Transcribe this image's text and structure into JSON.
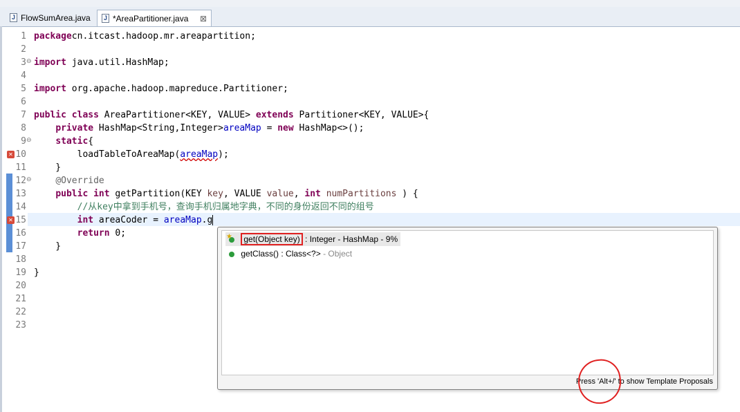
{
  "tabs": [
    {
      "label": "FlowSumArea.java",
      "active": false
    },
    {
      "label": "*AreaPartitioner.java",
      "active": true,
      "close": "⊠"
    }
  ],
  "lines": [
    {
      "n": "1",
      "segs": [
        [
          "kw",
          "package"
        ],
        [
          "",
          "cn.itcast.hadoop.mr.areapartition;"
        ]
      ]
    },
    {
      "n": "2",
      "segs": []
    },
    {
      "n": "3",
      "fold": "⊖",
      "segs": [
        [
          "kw",
          "import"
        ],
        [
          "",
          " java.util.HashMap;"
        ]
      ]
    },
    {
      "n": "4",
      "segs": []
    },
    {
      "n": "5",
      "segs": [
        [
          "kw",
          "import"
        ],
        [
          "",
          " org.apache.hadoop.mapreduce.Partitioner;"
        ]
      ]
    },
    {
      "n": "6",
      "segs": []
    },
    {
      "n": "7",
      "segs": [
        [
          "kw",
          "public class"
        ],
        [
          "",
          " AreaPartitioner<KEY, VALUE> "
        ],
        [
          "kw",
          "extends"
        ],
        [
          "",
          " Partitioner<KEY, VALUE>{"
        ]
      ]
    },
    {
      "n": "8",
      "segs": [
        [
          "",
          "    "
        ],
        [
          "kw",
          "private"
        ],
        [
          "",
          " HashMap<String,Integer>"
        ],
        [
          "field",
          "areaMap"
        ],
        [
          "",
          " = "
        ],
        [
          "kw",
          "new"
        ],
        [
          "",
          " HashMap<>();"
        ]
      ]
    },
    {
      "n": "9",
      "fold": "⊖",
      "segs": [
        [
          "",
          "    "
        ],
        [
          "kw",
          "static"
        ],
        [
          "",
          "{"
        ]
      ]
    },
    {
      "n": "10",
      "err": true,
      "segs": [
        [
          "",
          "        loadTableToAreaMap("
        ],
        [
          "field squig",
          "areaMap"
        ],
        [
          "",
          ");"
        ]
      ]
    },
    {
      "n": "11",
      "segs": [
        [
          "",
          "    }"
        ]
      ]
    },
    {
      "n": "12",
      "fold": "⊖",
      "segs": [
        [
          "",
          "    "
        ],
        [
          "ann",
          "@Override"
        ]
      ]
    },
    {
      "n": "13",
      "segs": [
        [
          "",
          "    "
        ],
        [
          "kw",
          "public int"
        ],
        [
          "",
          " getPartition(KEY "
        ],
        [
          "param",
          "key"
        ],
        [
          "",
          ", VALUE "
        ],
        [
          "param",
          "value"
        ],
        [
          "",
          ", "
        ],
        [
          "kw",
          "int"
        ],
        [
          "",
          " "
        ],
        [
          "param",
          "numPartitions"
        ],
        [
          "",
          " ) {"
        ]
      ]
    },
    {
      "n": "14",
      "segs": [
        [
          "",
          "        "
        ],
        [
          "cmt",
          "//从key中拿到手机号，查询手机归属地字典，不同的身份返回不同的组号"
        ]
      ]
    },
    {
      "n": "15",
      "err": true,
      "caret": true,
      "segs": [
        [
          "",
          "        "
        ],
        [
          "kw",
          "int"
        ],
        [
          "",
          " areaCoder = "
        ],
        [
          "field",
          "areaMap"
        ],
        [
          "",
          ".g"
        ]
      ]
    },
    {
      "n": "16",
      "segs": [
        [
          "",
          "        "
        ],
        [
          "kw",
          "return"
        ],
        [
          "",
          " 0;"
        ]
      ]
    },
    {
      "n": "17",
      "segs": [
        [
          "",
          "    }"
        ]
      ]
    },
    {
      "n": "18",
      "segs": []
    },
    {
      "n": "19",
      "segs": [
        [
          "",
          "}"
        ]
      ]
    },
    {
      "n": "20",
      "segs": []
    },
    {
      "n": "21",
      "segs": []
    },
    {
      "n": "22",
      "segs": []
    },
    {
      "n": "23",
      "segs": []
    }
  ],
  "popup": {
    "items": [
      {
        "sig": "get(Object key)",
        "rest": " : Integer - HashMap - 9%"
      },
      {
        "sig": "getClass() : Class<?>",
        "rest": " - Object"
      }
    ],
    "footer": "Press 'Alt+/' to show Template Proposals"
  },
  "colors": {
    "keyword": "#7f0055",
    "field": "#0000c0",
    "comment": "#3f7f5f",
    "annotation": "#ff0000"
  }
}
